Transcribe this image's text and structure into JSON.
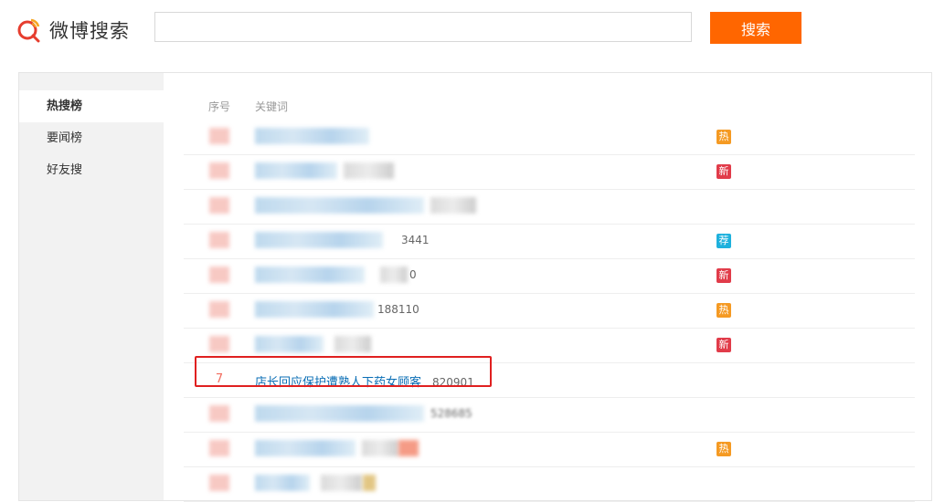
{
  "header": {
    "logo_text": "微博搜索",
    "search_value": "",
    "search_button": "搜索"
  },
  "sidebar": {
    "items": [
      {
        "label": "热搜榜",
        "active": true
      },
      {
        "label": "要闻榜",
        "active": false
      },
      {
        "label": "好友搜",
        "active": false
      }
    ]
  },
  "table": {
    "headers": {
      "rank": "序号",
      "keyword": "关键词"
    },
    "visible_row": {
      "rank": "7",
      "keyword": "店长回应保护遭熟人下药女顾客",
      "count": "820901"
    },
    "partial_counts": [
      "3441",
      "0",
      "188110",
      "528685"
    ],
    "badges": [
      "热",
      "新",
      "荐",
      "新",
      "热",
      "新",
      "热"
    ]
  },
  "colors": {
    "accent": "#ff6600",
    "hot": "#f59a23",
    "new": "#e13c4a",
    "rec": "#1eb1dd",
    "link": "#0a6eb5",
    "highlight": "#e02020"
  }
}
